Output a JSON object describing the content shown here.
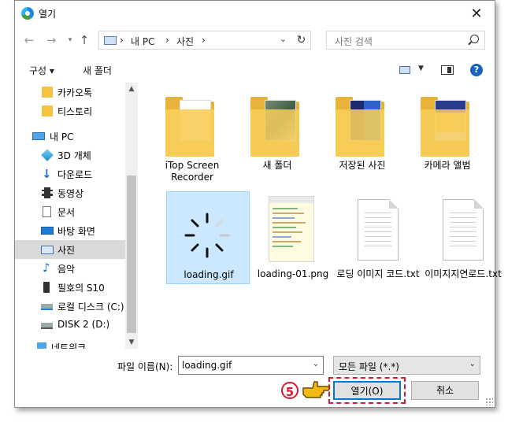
{
  "title": "열기",
  "nav": {
    "back": "←",
    "forward": "→",
    "up": "↑",
    "breadcrumb": [
      "내 PC",
      "사진"
    ],
    "separator": "›",
    "search_placeholder": "사진 검색"
  },
  "toolbar": {
    "organize": "구성 ▾",
    "new_folder": "새 폴더",
    "help": "?"
  },
  "sidebar": {
    "items": [
      {
        "label": "카카오톡",
        "icon": "folder-icon"
      },
      {
        "label": "티스토리",
        "icon": "folder-icon"
      },
      {
        "label": "내 PC",
        "icon": "pc-icon"
      },
      {
        "label": "3D 개체",
        "icon": "3d-objects-icon"
      },
      {
        "label": "다운로드",
        "icon": "download-icon"
      },
      {
        "label": "동영상",
        "icon": "video-icon"
      },
      {
        "label": "문서",
        "icon": "document-icon"
      },
      {
        "label": "바탕 화면",
        "icon": "desktop-icon"
      },
      {
        "label": "사진",
        "icon": "pictures-icon",
        "selected": true
      },
      {
        "label": "음악",
        "icon": "music-icon"
      },
      {
        "label": "필호의 S10",
        "icon": "phone-icon"
      },
      {
        "label": "로컬 디스크 (C:)",
        "icon": "drive-icon"
      },
      {
        "label": "DISK 2 (D:)",
        "icon": "drive-icon"
      },
      {
        "label": "네트워크",
        "icon": "network-icon"
      }
    ]
  },
  "files": [
    {
      "name": "iTop Screen Recorder",
      "type": "folder"
    },
    {
      "name": "새 폴더",
      "type": "folder"
    },
    {
      "name": "저장된 사진",
      "type": "folder"
    },
    {
      "name": "카메라 앨범",
      "type": "folder"
    },
    {
      "name": "loading.gif",
      "type": "gif",
      "selected": true
    },
    {
      "name": "loading-01.png",
      "type": "png"
    },
    {
      "name": "로딩 이미지 코드.txt",
      "type": "txt"
    },
    {
      "name": "이미지지연로드.txt",
      "type": "txt"
    }
  ],
  "footer": {
    "filename_label": "파일 이름(N):",
    "filename_value": "loading.gif",
    "filetype_value": "모든 파일 (*.*)",
    "open_label": "열기(O)",
    "cancel_label": "취소"
  },
  "annotation": {
    "step_number": "5"
  },
  "colors": {
    "accent": "#0078d7",
    "highlight": "#e0182d",
    "selection": "#cce8ff"
  }
}
